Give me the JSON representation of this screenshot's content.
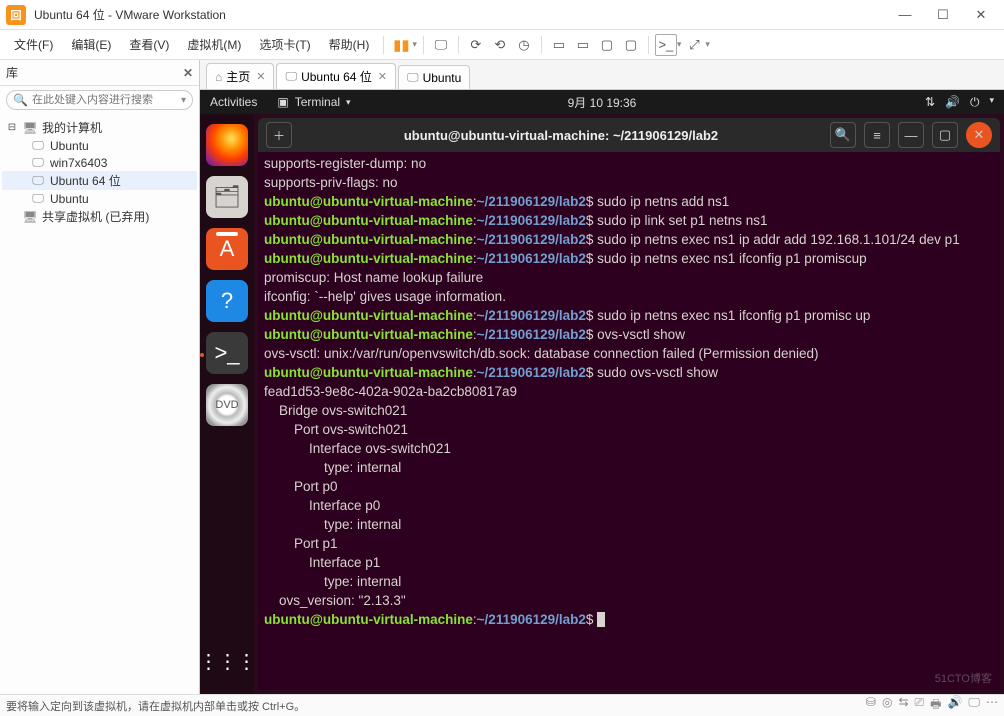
{
  "window": {
    "title": "Ubuntu 64 位 - VMware Workstation",
    "app_abbrev": "回"
  },
  "menu": {
    "file": "文件(F)",
    "edit": "编辑(E)",
    "view": "查看(V)",
    "vm": "虚拟机(M)",
    "tabs": "选项卡(T)",
    "help": "帮助(H)"
  },
  "library": {
    "header": "库",
    "search_placeholder": "在此处键入内容进行搜索",
    "root": "我的计算机",
    "items": [
      "Ubuntu",
      "win7x6403",
      "Ubuntu 64 位",
      "Ubuntu"
    ],
    "shared": "共享虚拟机 (已弃用)"
  },
  "tabs": {
    "home": "主页",
    "vm1": "Ubuntu 64 位",
    "vm2": "Ubuntu"
  },
  "gnome": {
    "activities": "Activities",
    "app": "Terminal",
    "clock": "9月 10  19:36"
  },
  "terminal": {
    "title": "ubuntu@ubuntu-virtual-machine: ~/211906129/lab2",
    "prompt_user": "ubuntu@ubuntu-virtual-machine",
    "prompt_path": "~/211906129/lab2",
    "lines": {
      "l1": "supports-register-dump: no",
      "l2": "supports-priv-flags: no",
      "c1": "sudo ip netns add ns1",
      "c2": "sudo ip link set p1 netns ns1",
      "c3": "sudo ip netns exec ns1 ip addr add 192.168.1.101/24 dev p1",
      "c4": "sudo ip netns exec ns1 ifconfig p1 promiscup",
      "e1": "promiscup: Host name lookup failure",
      "e2": "ifconfig: `--help' gives usage information.",
      "c5": "sudo ip netns exec ns1 ifconfig p1 promisc up",
      "c6": "ovs-vsctl show",
      "e3": "ovs-vsctl: unix:/var/run/openvswitch/db.sock: database connection failed (Permission denied)",
      "c7": "sudo ovs-vsctl show",
      "o1": "fead1d53-9e8c-402a-902a-ba2cb80817a9",
      "o2": "    Bridge ovs-switch021",
      "o3": "        Port ovs-switch021",
      "o4": "            Interface ovs-switch021",
      "o5": "                type: internal",
      "o6": "        Port p0",
      "o7": "            Interface p0",
      "o8": "                type: internal",
      "o9": "        Port p1",
      "o10": "            Interface p1",
      "o11": "                type: internal",
      "o12": "    ovs_version: \"2.13.3\""
    }
  },
  "statusbar": {
    "hint": "要将输入定向到该虚拟机，请在虚拟机内部单击或按 Ctrl+G。"
  },
  "watermark": "51CTO博客"
}
